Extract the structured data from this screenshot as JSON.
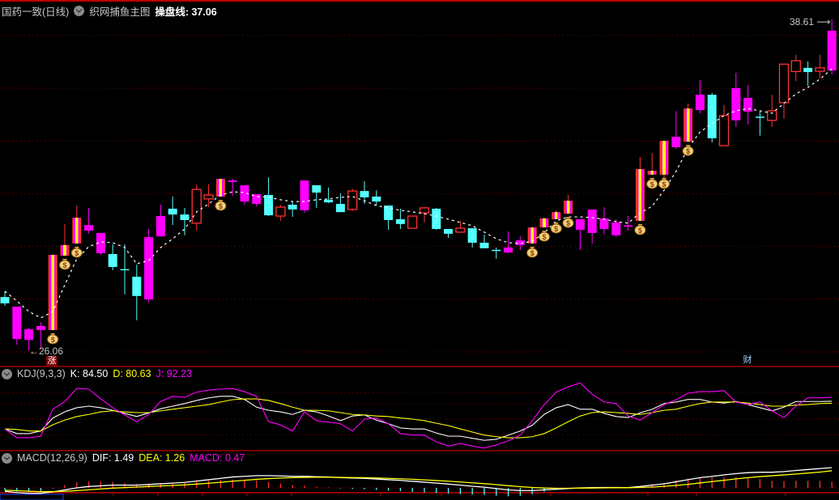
{
  "header": {
    "stock_title": "国药一致(日线)",
    "indicator_name": "织网捕鱼主图",
    "line_label": "操盘线: 37.06"
  },
  "kdj_legend": {
    "name": "KDJ(9,3,3)",
    "k": "K: 84.50",
    "d": "D: 80.63",
    "j": "J: 92.23"
  },
  "macd_legend": {
    "name": "MACD(12,26,9)",
    "dif": "DIF: 1.49",
    "dea": "DEA: 1.26",
    "macd": "MACD: 0.47"
  },
  "annotations": {
    "high_label": "38.61",
    "low_label": "26.06",
    "signal_badge": "涨",
    "finance_badge": "财",
    "money_bag_glyph": "$"
  },
  "colors": {
    "up": "#ff3232",
    "down": "#54ffff",
    "magenta": "#ff00ff",
    "yellow": "#ffff00",
    "grid": "#8b0000",
    "k": "#ffffff",
    "d": "#ffff00",
    "j": "#ff00ff"
  },
  "chart_data": [
    {
      "type": "candlestick",
      "title": "国药一致(日线) 织网捕鱼主图",
      "ylim": [
        25.4,
        39.6
      ],
      "gridlines": [
        26,
        28,
        30,
        32,
        34,
        36,
        38
      ],
      "candle_fields": [
        "style",
        "open",
        "high",
        "low",
        "close"
      ],
      "candles": [
        [
          "down",
          28.08,
          28.3,
          27.75,
          27.84
        ],
        [
          "mag",
          27.72,
          27.72,
          26.27,
          26.49
        ],
        [
          "mag",
          26.86,
          26.92,
          26.06,
          26.46
        ],
        [
          "mag",
          26.83,
          27.13,
          26.12,
          26.98
        ],
        [
          "sig",
          26.83,
          29.68,
          26.83,
          29.68
        ],
        [
          "sig",
          29.65,
          30.85,
          29.65,
          30.05
        ],
        [
          "sig",
          30.11,
          31.55,
          30.11,
          31.09
        ],
        [
          "mag",
          30.6,
          31.46,
          30.48,
          30.81
        ],
        [
          "mag",
          30.51,
          30.51,
          29.68,
          29.74
        ],
        [
          "down",
          29.71,
          30.08,
          29.1,
          29.22
        ],
        [
          "down",
          29.14,
          30.08,
          28.18,
          29.12
        ],
        [
          "down",
          28.85,
          29.31,
          27.2,
          28.12
        ],
        [
          "mag",
          27.99,
          30.66,
          27.87,
          30.35
        ],
        [
          "mag",
          30.38,
          31.58,
          30.38,
          31.15
        ],
        [
          "down",
          31.43,
          31.89,
          30.81,
          31.21
        ],
        [
          "down",
          31.21,
          31.46,
          30.42,
          31.0
        ],
        [
          "up",
          30.88,
          32.35,
          30.6,
          32.16
        ],
        [
          "up",
          31.8,
          32.35,
          31.49,
          31.95
        ],
        [
          "sig",
          31.89,
          32.56,
          31.89,
          32.56
        ],
        [
          "mag",
          32.44,
          32.56,
          31.92,
          32.5
        ],
        [
          "mag",
          32.32,
          32.32,
          31.58,
          31.7
        ],
        [
          "mag",
          31.98,
          31.98,
          31.52,
          31.61
        ],
        [
          "down",
          31.95,
          32.62,
          31.15,
          31.18
        ],
        [
          "up",
          31.15,
          31.58,
          30.97,
          31.49
        ],
        [
          "down",
          31.58,
          31.7,
          31.12,
          31.4
        ],
        [
          "mag",
          31.37,
          32.5,
          31.27,
          32.5
        ],
        [
          "down",
          32.32,
          32.32,
          31.46,
          32.04
        ],
        [
          "down",
          31.77,
          32.23,
          31.64,
          31.67
        ],
        [
          "down",
          31.61,
          32.01,
          31.3,
          31.3
        ],
        [
          "up",
          31.4,
          32.19,
          31.34,
          32.1
        ],
        [
          "down",
          32.1,
          32.47,
          31.61,
          31.86
        ],
        [
          "down",
          31.89,
          32.13,
          31.55,
          31.7
        ],
        [
          "down",
          31.55,
          31.55,
          30.63,
          31.0
        ],
        [
          "down",
          31.03,
          31.43,
          30.66,
          30.85
        ],
        [
          "up",
          30.69,
          31.15,
          30.69,
          31.15
        ],
        [
          "up",
          31.27,
          31.49,
          30.91,
          31.46
        ],
        [
          "down",
          31.43,
          31.46,
          30.63,
          30.66
        ],
        [
          "down",
          30.66,
          30.66,
          30.32,
          30.48
        ],
        [
          "up",
          30.54,
          30.97,
          30.54,
          30.69
        ],
        [
          "down",
          30.69,
          30.69,
          29.96,
          30.14
        ],
        [
          "down",
          30.14,
          30.45,
          29.93,
          29.93
        ],
        [
          "down",
          29.87,
          29.96,
          29.53,
          29.86
        ],
        [
          "mag",
          29.77,
          30.57,
          29.74,
          29.96
        ],
        [
          "mag",
          30.05,
          30.38,
          29.86,
          30.23
        ],
        [
          "sig",
          30.11,
          30.72,
          30.11,
          30.72
        ],
        [
          "sig",
          30.72,
          31.1,
          30.72,
          31.06
        ],
        [
          "sig",
          31.03,
          31.37,
          31.03,
          31.3
        ],
        [
          "sig",
          31.24,
          31.95,
          31.24,
          31.73
        ],
        [
          "mag",
          31.03,
          31.03,
          29.86,
          30.63
        ],
        [
          "mag",
          30.51,
          31.4,
          30.11,
          31.4
        ],
        [
          "mag",
          31.06,
          31.49,
          30.45,
          30.66
        ],
        [
          "mag",
          30.91,
          31.03,
          30.35,
          30.42
        ],
        [
          "mag",
          30.78,
          31.15,
          30.6,
          30.8
        ],
        [
          "sig",
          30.97,
          33.39,
          30.97,
          32.93
        ],
        [
          "sig",
          32.72,
          33.54,
          32.72,
          32.87
        ],
        [
          "sig",
          32.72,
          34.0,
          32.5,
          34.0
        ],
        [
          "mag",
          33.76,
          35.13,
          33.7,
          34.16
        ],
        [
          "sig",
          33.97,
          35.42,
          33.97,
          35.23
        ],
        [
          "mag",
          35.17,
          36.3,
          35.05,
          35.75
        ],
        [
          "down",
          35.75,
          35.81,
          33.94,
          34.1
        ],
        [
          "up",
          33.82,
          35.36,
          33.82,
          34.96
        ],
        [
          "mag",
          34.78,
          36.58,
          34.53,
          36.0
        ],
        [
          "mag",
          35.63,
          36.12,
          34.62,
          35.11
        ],
        [
          "down",
          34.92,
          35.11,
          34.2,
          34.9
        ],
        [
          "up",
          34.78,
          35.75,
          34.53,
          35.14
        ],
        [
          "up",
          35.45,
          36.91,
          34.84,
          36.91
        ],
        [
          "up",
          36.63,
          37.26,
          36.27,
          37.04
        ],
        [
          "down",
          36.77,
          37.01,
          36.09,
          36.61
        ],
        [
          "up",
          36.64,
          37.26,
          36.37,
          36.77
        ],
        [
          "mag",
          36.67,
          38.61,
          36.52,
          38.18
        ]
      ],
      "money_bag_signals": [
        4,
        5,
        6,
        18,
        44,
        45,
        46,
        47,
        53,
        54,
        55,
        57
      ],
      "operating_line": {
        "name": "操盘线",
        "values": [
          28.3,
          27.93,
          27.53,
          27.29,
          27.53,
          28.54,
          29.53,
          29.99,
          30.17,
          30.14,
          29.96,
          29.34,
          29.46,
          29.96,
          30.29,
          30.66,
          31.31,
          31.61,
          31.95,
          32.07,
          32.04,
          31.89,
          31.86,
          31.77,
          31.7,
          31.7,
          31.77,
          31.8,
          31.86,
          31.89,
          31.73,
          31.55,
          31.46,
          31.37,
          31.31,
          31.24,
          31.15,
          31.03,
          30.91,
          30.78,
          30.54,
          30.29,
          30.14,
          30.11,
          30.2,
          30.51,
          30.97,
          31.12,
          31.12,
          31.09,
          31.03,
          30.94,
          30.88,
          31.27,
          31.52,
          32.13,
          32.84,
          33.73,
          34.34,
          34.65,
          34.96,
          35.14,
          35.23,
          35.14,
          35.05,
          35.42,
          35.78,
          36.03,
          36.34,
          36.73
        ]
      }
    },
    {
      "type": "line",
      "title": "KDJ(9,3,3)",
      "gridlines": [
        20,
        50,
        80,
        100
      ],
      "series": [
        {
          "name": "K",
          "values": [
            31,
            22,
            22,
            27,
            52,
            64,
            72,
            75,
            72,
            67,
            61,
            55,
            62,
            70,
            75,
            80,
            86,
            91,
            94,
            94,
            88,
            73,
            67,
            64,
            59,
            67,
            64,
            56,
            47,
            56,
            58,
            48,
            41,
            33,
            31,
            31,
            23,
            17,
            17,
            13,
            9,
            11,
            19,
            27,
            38,
            59,
            72,
            78,
            69,
            69,
            61,
            55,
            53,
            62,
            69,
            80,
            83,
            88,
            88,
            83,
            81,
            84,
            78,
            72,
            66,
            73,
            84,
            84,
            84,
            84.5
          ]
        },
        {
          "name": "D",
          "values": [
            31,
            30,
            27,
            27,
            39,
            48,
            55,
            59,
            64,
            66,
            64,
            62.5,
            62.5,
            66,
            69,
            72,
            75,
            78,
            83,
            87.5,
            89,
            89,
            86,
            80,
            73,
            67,
            67,
            66,
            62.5,
            59,
            58,
            56,
            55,
            52,
            50,
            47,
            42,
            37.5,
            31,
            25,
            19,
            16,
            14,
            14,
            16,
            22,
            33,
            45,
            56,
            62.5,
            64,
            62.5,
            61,
            59,
            62.5,
            67,
            69,
            75,
            80,
            83,
            83,
            83,
            81,
            78,
            75,
            75,
            77,
            78,
            80,
            80.63
          ]
        },
        {
          "name": "J",
          "values": [
            31,
            14,
            14,
            17,
            69,
            84,
            109,
            108,
            89,
            72,
            58,
            45,
            59,
            84,
            94,
            92,
            102,
            106,
            108,
            109,
            103,
            94,
            45,
            39,
            27,
            64,
            47,
            44,
            41,
            27,
            50,
            52,
            41,
            22,
            19,
            19,
            6,
            -2,
            3,
            -2,
            -6,
            0,
            8,
            19,
            47,
            78,
            102,
            112,
            120,
            98,
            83,
            80,
            56,
            48,
            62.5,
            78,
            87.5,
            100,
            103,
            103,
            105,
            83,
            78,
            83,
            66,
            53,
            75,
            91,
            91,
            92.23
          ]
        }
      ]
    },
    {
      "type": "bar+line",
      "title": "MACD(12,26,9)",
      "series": [
        {
          "name": "DIF",
          "values": [
            -0.25,
            -0.35,
            -0.4,
            -0.4,
            -0.3,
            -0.15,
            0,
            0.1,
            0.15,
            0.2,
            0.2,
            0.2,
            0.25,
            0.3,
            0.35,
            0.4,
            0.5,
            0.6,
            0.7,
            0.8,
            0.85,
            0.9,
            0.9,
            0.88,
            0.85,
            0.85,
            0.82,
            0.8,
            0.75,
            0.72,
            0.7,
            0.65,
            0.6,
            0.55,
            0.48,
            0.42,
            0.35,
            0.28,
            0.2,
            0.12,
            0.05,
            -0.05,
            -0.15,
            -0.2,
            -0.2,
            -0.15,
            -0.1,
            -0.05,
            0,
            0.02,
            0.03,
            0.03,
            0.02,
            0.1,
            0.2,
            0.3,
            0.45,
            0.6,
            0.75,
            0.85,
            0.95,
            1.05,
            1.12,
            1.15,
            1.15,
            1.2,
            1.28,
            1.35,
            1.42,
            1.49
          ]
        },
        {
          "name": "DEA",
          "values": [
            -0.17,
            -0.21,
            -0.25,
            -0.28,
            -0.28,
            -0.25,
            -0.2,
            -0.14,
            -0.08,
            -0.02,
            0.02,
            0.06,
            0.1,
            0.14,
            0.18,
            0.22,
            0.28,
            0.34,
            0.41,
            0.49,
            0.56,
            0.63,
            0.68,
            0.72,
            0.75,
            0.77,
            0.78,
            0.78,
            0.77,
            0.76,
            0.75,
            0.73,
            0.7,
            0.67,
            0.63,
            0.59,
            0.54,
            0.49,
            0.43,
            0.37,
            0.31,
            0.24,
            0.16,
            0.09,
            0.03,
            -0.01,
            -0.03,
            -0.03,
            -0.02,
            -0.01,
            0,
            0.01,
            0.01,
            0.03,
            0.06,
            0.11,
            0.18,
            0.26,
            0.36,
            0.46,
            0.56,
            0.66,
            0.75,
            0.83,
            0.89,
            0.95,
            1.02,
            1.09,
            1.16,
            1.26
          ]
        }
      ]
    }
  ]
}
